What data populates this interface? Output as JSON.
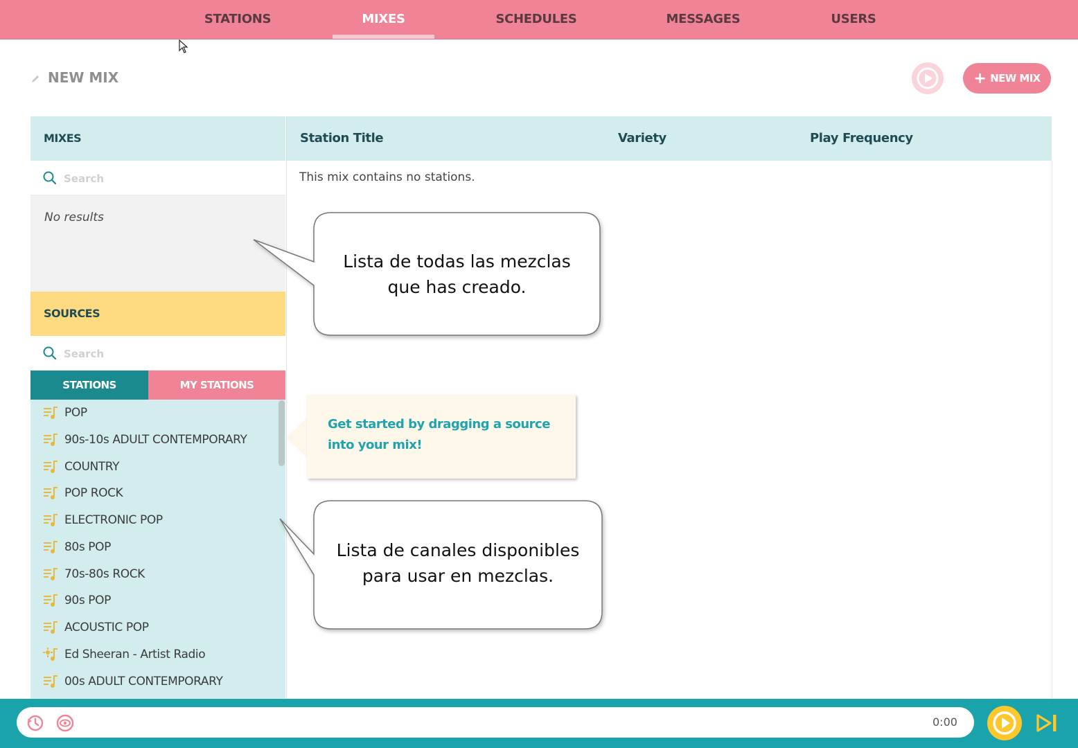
{
  "nav": {
    "tabs": [
      {
        "label": "STATIONS"
      },
      {
        "label": "MIXES"
      },
      {
        "label": "SCHEDULES"
      },
      {
        "label": "MESSAGES"
      },
      {
        "label": "USERS"
      }
    ],
    "active": "MIXES"
  },
  "header": {
    "title": "NEW MIX",
    "new_mix_label": "NEW MIX"
  },
  "mixes": {
    "heading": "MIXES",
    "search_placeholder": "Search",
    "empty_text": "No results"
  },
  "sources": {
    "heading": "SOURCES",
    "search_placeholder": "Search",
    "tabs": {
      "stations": "STATIONS",
      "my_stations": "MY STATIONS"
    },
    "items": [
      {
        "label": "POP",
        "icon": "playlist-icon"
      },
      {
        "label": "90s-10s ADULT CONTEMPORARY",
        "icon": "playlist-icon"
      },
      {
        "label": "COUNTRY",
        "icon": "playlist-icon"
      },
      {
        "label": "POP ROCK",
        "icon": "playlist-icon"
      },
      {
        "label": "ELECTRONIC POP",
        "icon": "playlist-icon"
      },
      {
        "label": "80s POP",
        "icon": "playlist-icon"
      },
      {
        "label": "70s-80s ROCK",
        "icon": "playlist-icon"
      },
      {
        "label": "90s POP",
        "icon": "playlist-icon"
      },
      {
        "label": "ACOUSTIC POP",
        "icon": "playlist-icon"
      },
      {
        "label": "Ed Sheeran - Artist Radio",
        "icon": "artist-radio-icon"
      },
      {
        "label": "00s ADULT CONTEMPORARY",
        "icon": "playlist-icon"
      }
    ]
  },
  "table": {
    "columns": [
      "Station Title",
      "Variety",
      "Play Frequency"
    ],
    "empty_text": "This mix contains no stations."
  },
  "tip": {
    "text": "Get started by dragging a source into your mix!"
  },
  "callouts": {
    "mixes_line1": "Lista de todas las mezclas",
    "mixes_line2": "que has creado.",
    "sources_line1": "Lista de canales disponibles",
    "sources_line2": "para usar en mezclas."
  },
  "player": {
    "time": "0:00"
  },
  "colors": {
    "nav_pink": "#f08496",
    "teal": "#1ba3ab",
    "light_teal": "#d3ecee",
    "yellow": "#fedb80",
    "play_yellow": "#fec72c"
  }
}
